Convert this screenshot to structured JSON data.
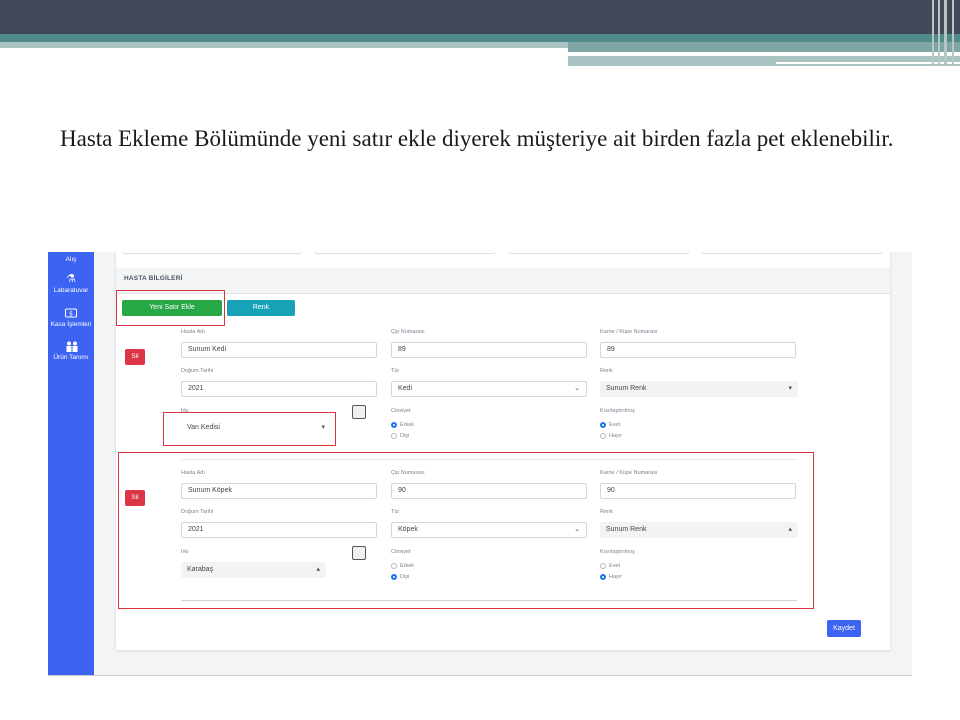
{
  "slide": {
    "caption": "Hasta Ekleme Bölümünde yeni satır ekle diyerek müşteriye ait birden fazla pet eklenebilir."
  },
  "sidebar": {
    "items": [
      {
        "label": "Alış",
        "icon": "cart-icon"
      },
      {
        "label": "Labaratuvar",
        "icon": "flask-icon"
      },
      {
        "label": "Kasa İşlemleri",
        "icon": "cash-icon"
      },
      {
        "label": "Ürün Tanımı",
        "icon": "people-icon"
      }
    ]
  },
  "section": {
    "title": "HASTA BİLGİLERİ",
    "add_row_label": "Yeni Satır Ekle",
    "color_label": "Renk"
  },
  "rows": [
    {
      "delete_label": "Sil",
      "patient_name_label": "Hasta Adı",
      "patient_name": "Sunum Kedi",
      "chip_label": "Çip Numarası",
      "chip": "89",
      "ear_tag_label": "Karne / Küpe Numarası",
      "ear_tag": "89",
      "birth_label": "Doğum Tarihi",
      "birth": "2021",
      "type_label": "Tür",
      "type": "Kedi",
      "color_label": "Renk",
      "color": "Sunum Renk",
      "breed_label": "Irkı",
      "breed": "Van Kedisi",
      "gender_label": "Cinsiyet",
      "gender_options": [
        "Erkek",
        "Dişi"
      ],
      "gender_selected": "Erkek",
      "neutered_label": "Kısırlaştırılmış",
      "neutered_options": [
        "Evet",
        "Hayır"
      ],
      "neutered_selected": "Evet"
    },
    {
      "delete_label": "Sil",
      "patient_name_label": "Hasta Adı",
      "patient_name": "Sunum Köpek",
      "chip_label": "Çip Numarası",
      "chip": "90",
      "ear_tag_label": "Karne / Küpe Numarası",
      "ear_tag": "90",
      "birth_label": "Doğum Tarihi",
      "birth": "2021",
      "type_label": "Tür",
      "type": "Köpek",
      "color_label": "Renk",
      "color": "Sunum Renk",
      "breed_label": "Irkı",
      "breed": "Karabaş",
      "gender_label": "Cinsiyet",
      "gender_options": [
        "Erkek",
        "Dişi"
      ],
      "gender_selected": "Dişi",
      "neutered_label": "Kısırlaştırılmış",
      "neutered_options": [
        "Evet",
        "Hayır"
      ],
      "neutered_selected": "Hayır"
    }
  ],
  "footer": {
    "save_label": "Kaydet"
  },
  "colors": {
    "sidebar": "#3d63f2",
    "highlight": "#d93640",
    "add_button": "#28a745",
    "color_button": "#17a2b8"
  }
}
